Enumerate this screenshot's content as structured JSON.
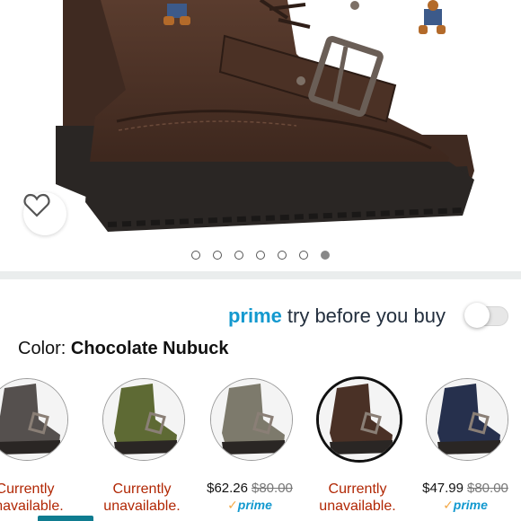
{
  "colors": {
    "prime_blue": "#1399cf",
    "unavailable_red": "#b12704",
    "strike_gray": "#777777",
    "boot_brown": "#4a3126",
    "accent_teal": "#0f7c90"
  },
  "gallery": {
    "image_count": 7,
    "active_index": 6,
    "wishlist_icon": "heart-outline-icon"
  },
  "prime_row": {
    "prime_label": "prime",
    "try_text": "try before you buy",
    "toggle_on": false
  },
  "color": {
    "label": "Color:",
    "selected": "Chocolate Nubuck"
  },
  "swatches": [
    {
      "color_hex": "#55504e",
      "status": "Currently unavailable.",
      "selected": false
    },
    {
      "color_hex": "#5e6a34",
      "status": "Currently unavailable.",
      "selected": false
    },
    {
      "color_hex": "#7d7a6c",
      "price": "$62.26",
      "list_price": "$80.00",
      "prime": "prime",
      "selected": false
    },
    {
      "color_hex": "#4a3126",
      "status": "Currently unavailable.",
      "selected": true
    },
    {
      "color_hex": "#26304d",
      "price": "$47.99",
      "list_price": "$80.00",
      "prime": "prime",
      "selected": false
    }
  ]
}
